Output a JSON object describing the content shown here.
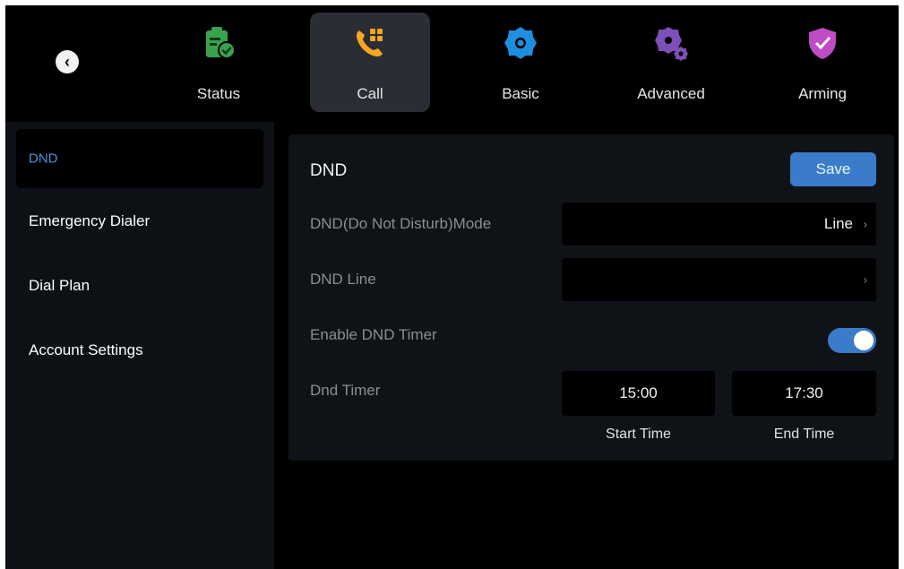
{
  "nav": {
    "back_icon": "chevron-left-icon",
    "tabs": [
      {
        "label": "Status",
        "icon": "clipboard-check-icon",
        "color": "#3aa14e",
        "active": false
      },
      {
        "label": "Call",
        "icon": "phone-keypad-icon",
        "color": "#f5a623",
        "active": true
      },
      {
        "label": "Basic",
        "icon": "gear-icon",
        "color": "#1e8fe0",
        "active": false
      },
      {
        "label": "Advanced",
        "icon": "gears-icon",
        "color": "#7d4fb8",
        "active": false
      },
      {
        "label": "Arming",
        "icon": "shield-check-icon",
        "color": "#c04bc6",
        "active": false
      }
    ]
  },
  "sidebar": {
    "items": [
      {
        "label": "DND",
        "active": true
      },
      {
        "label": "Emergency Dialer",
        "active": false
      },
      {
        "label": "Dial Plan",
        "active": false
      },
      {
        "label": "Account Settings",
        "active": false
      }
    ]
  },
  "panel": {
    "title": "DND",
    "save_label": "Save",
    "rows": {
      "mode": {
        "label": "DND(Do Not Disturb)Mode",
        "value": "Line"
      },
      "line": {
        "label": "DND Line",
        "value": ""
      },
      "timer_enable": {
        "label": "Enable DND Timer",
        "enabled": true
      },
      "timer": {
        "label": "Dnd Timer",
        "start": "15:00",
        "end": "17:30",
        "start_caption": "Start Time",
        "end_caption": "End Time"
      }
    }
  },
  "colors": {
    "accent": "#3a7cc9",
    "active_text": "#4f8fd9"
  }
}
